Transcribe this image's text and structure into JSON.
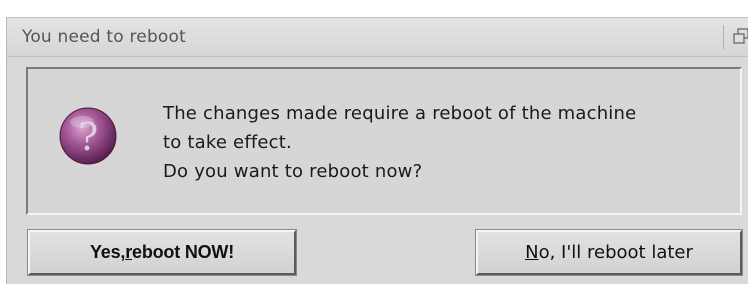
{
  "dialog": {
    "title": "You need to reboot",
    "message_lines": [
      "The changes made require a reboot of the machine",
      "to take effect.",
      "Do you want to reboot now?"
    ],
    "icon": "question-icon",
    "yes_button": {
      "before": "Yes, ",
      "mnemonic": "r",
      "after": "eboot NOW!"
    },
    "no_button": {
      "before": "",
      "mnemonic": "N",
      "after": "o, I'll reboot later"
    }
  },
  "titlebar": {
    "restore_icon": "restore-icon"
  },
  "colors": {
    "window_bg": "#d9d9d9",
    "icon_purple": "#8a3f7e"
  }
}
